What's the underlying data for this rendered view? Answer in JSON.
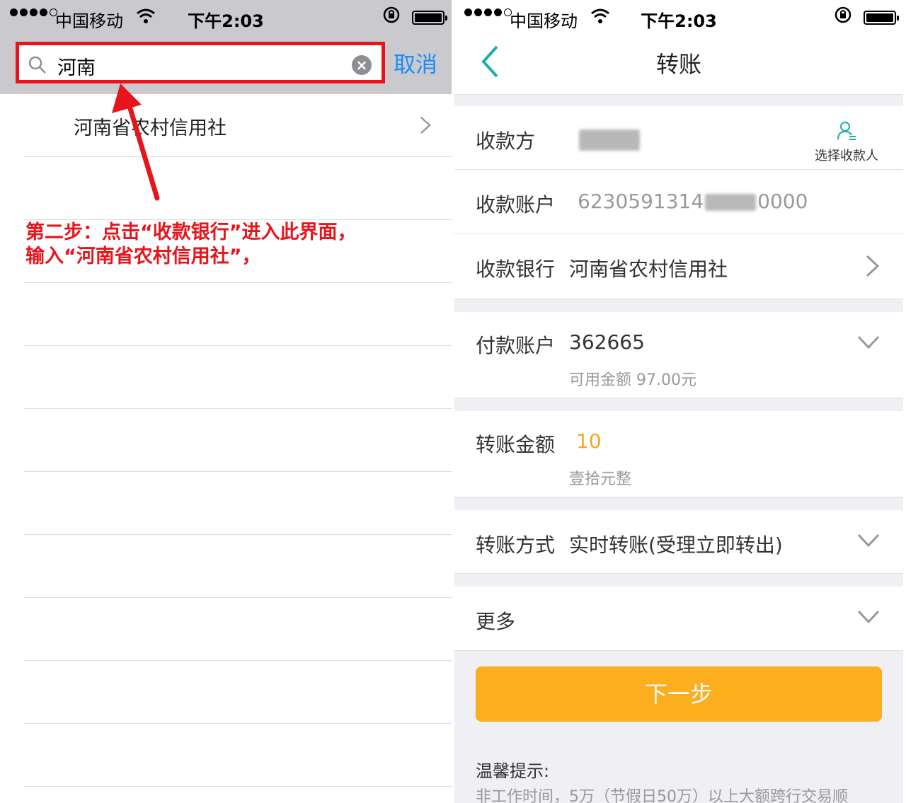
{
  "status_bar": {
    "carrier": "中国移动",
    "time": "下午2:03"
  },
  "left": {
    "search": {
      "value": "河南",
      "cancel_label": "取消"
    },
    "results": [
      {
        "label": "河南省农村信用社"
      }
    ],
    "annotation": {
      "line1": "第二步：点击“收款银行”进入此界面，",
      "line2": "输入“河南省农村信用社”，",
      "color": "#e8141b"
    }
  },
  "right": {
    "nav_title": "转账",
    "payee": {
      "label": "收款方",
      "pick_label": "选择收款人"
    },
    "payee_account": {
      "label": "收款账户",
      "prefix": "6230591314",
      "suffix": "0000"
    },
    "payee_bank": {
      "label": "收款银行",
      "value": "河南省农村信用社"
    },
    "payer_account": {
      "label": "付款账户",
      "value": "362665",
      "available": "可用金额 97.00元"
    },
    "amount": {
      "label": "转账金额",
      "value": "10",
      "in_words": "壹拾元整"
    },
    "transfer_mode": {
      "label": "转账方式",
      "value": "实时转账(受理立即转出)"
    },
    "more": {
      "label": "更多"
    },
    "next_button": "下一步",
    "tips": {
      "title": "温馨提示:",
      "text": "非工作时间，5万（节假日50万）以上大额跨行交易顺"
    },
    "accent_color": "#fbae1e",
    "link_color": "#1a8cff"
  }
}
